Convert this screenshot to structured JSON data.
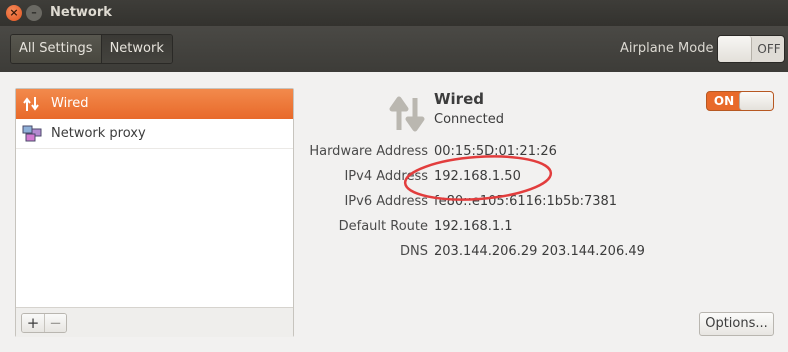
{
  "window": {
    "title": "Network",
    "close_glyph": "×",
    "minimize_glyph": "–"
  },
  "toolbar": {
    "crumbs": [
      "All Settings",
      "Network"
    ],
    "airplane_label": "Airplane Mode",
    "airplane_state": "OFF"
  },
  "sidebar": {
    "items": [
      {
        "label": "Wired",
        "icon": "wired-arrows-icon",
        "selected": true
      },
      {
        "label": "Network proxy",
        "icon": "network-proxy-icon",
        "selected": false
      }
    ],
    "add_glyph": "+",
    "remove_glyph": "−"
  },
  "connection": {
    "name": "Wired",
    "status": "Connected",
    "switch_state": "ON",
    "details": [
      {
        "key": "Hardware Address",
        "value": "00:15:5D:01:21:26"
      },
      {
        "key": "IPv4 Address",
        "value": "192.168.1.50"
      },
      {
        "key": "IPv6 Address",
        "value": "fe80::e105:6116:1b5b:7381"
      },
      {
        "key": "Default Route",
        "value": "192.168.1.1"
      },
      {
        "key": "DNS",
        "value": "203.144.206.29 203.144.206.49"
      }
    ],
    "options_label": "Options..."
  },
  "colors": {
    "accent": "#e8692a",
    "annotation": "#e23d3d"
  }
}
